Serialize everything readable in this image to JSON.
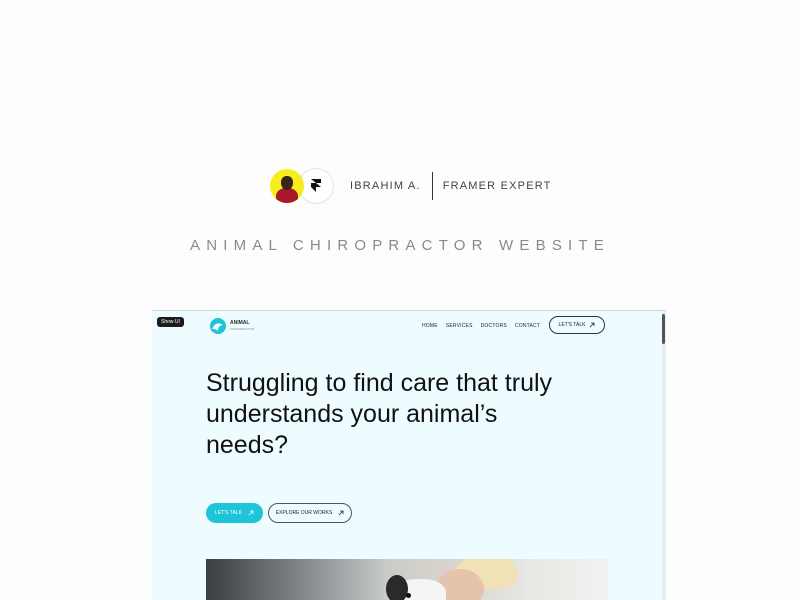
{
  "credit": {
    "author_name": "IBRAHIM A.",
    "role": "FRAMER EXPERT",
    "avatar_icon": "user-avatar",
    "brand_icon": "framer-logo-icon"
  },
  "project_title": "ANIMAL CHIROPRACTOR WEBSITE",
  "preview": {
    "show_ui_label": "Show UI",
    "logo": {
      "icon": "wave-logo-icon",
      "name": "ANIMAL",
      "tagline": "CHIROPRACTOR"
    },
    "nav": {
      "items": [
        "HOME",
        "SERVICES",
        "DOCTORS",
        "CONTACT"
      ],
      "cta_label": "LET'S TALK",
      "cta_icon": "arrow-up-right-icon"
    },
    "hero": {
      "title": "Struggling to find care that truly understands your animal’s needs?",
      "primary_label": "LET'S TALK",
      "secondary_label": "EXPLORE OUR WORKS",
      "button_icon": "arrow-up-right-icon"
    },
    "colors": {
      "accent": "#1ec4d8",
      "background": "#eefcff"
    }
  }
}
